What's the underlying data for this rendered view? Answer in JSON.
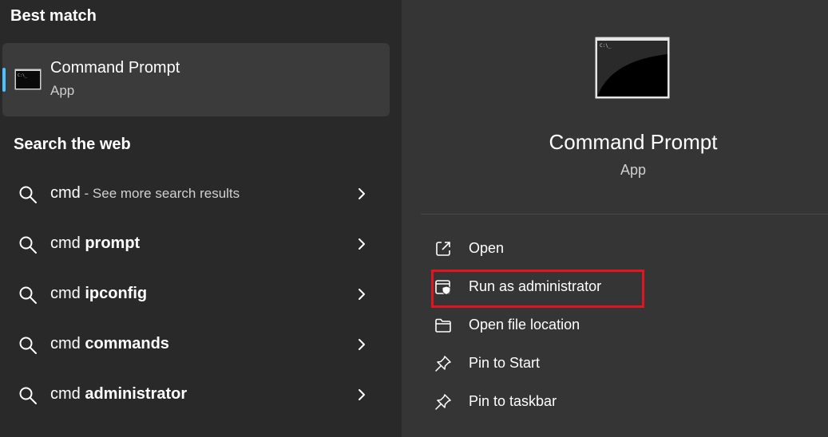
{
  "best_match": {
    "title": "Best match",
    "app_name": "Command Prompt",
    "app_type": "App"
  },
  "search_web": {
    "title": "Search the web",
    "items": [
      {
        "prefix": "cmd",
        "bold": "",
        "suffix": " - See more search results"
      },
      {
        "prefix": "cmd ",
        "bold": "prompt",
        "suffix": ""
      },
      {
        "prefix": "cmd ",
        "bold": "ipconfig",
        "suffix": ""
      },
      {
        "prefix": "cmd ",
        "bold": "commands",
        "suffix": ""
      },
      {
        "prefix": "cmd ",
        "bold": "administrator",
        "suffix": ""
      }
    ]
  },
  "details": {
    "app_name": "Command Prompt",
    "app_type": "App",
    "actions": [
      {
        "label": "Open",
        "icon": "open-external-icon"
      },
      {
        "label": "Run as administrator",
        "icon": "shield-window-icon"
      },
      {
        "label": "Open file location",
        "icon": "folder-icon"
      },
      {
        "label": "Pin to Start",
        "icon": "pin-icon"
      },
      {
        "label": "Pin to taskbar",
        "icon": "pin-icon"
      }
    ]
  },
  "colors": {
    "accent": "#4cc2ff",
    "highlight_box": "#e0151f",
    "left_bg": "#292929",
    "right_bg": "#353535",
    "selected_bg": "#3b3b3b"
  }
}
